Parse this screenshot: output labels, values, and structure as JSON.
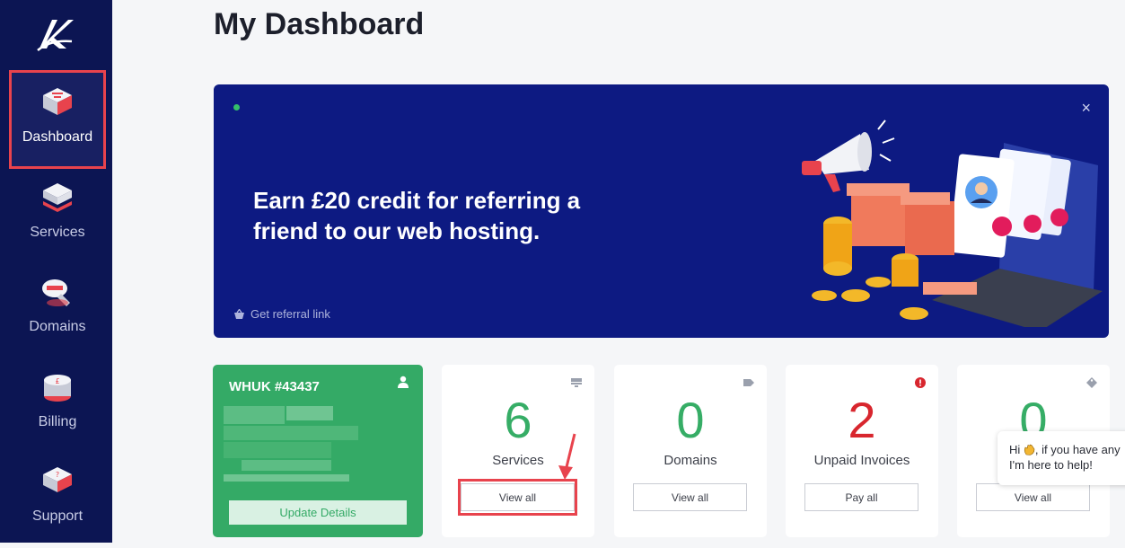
{
  "sidebar": {
    "items": [
      {
        "label": "Dashboard",
        "icon": "dashboard-icon",
        "active": true
      },
      {
        "label": "Services",
        "icon": "services-icon"
      },
      {
        "label": "Domains",
        "icon": "domains-icon"
      },
      {
        "label": "Billing",
        "icon": "billing-icon"
      },
      {
        "label": "Support",
        "icon": "support-icon"
      }
    ]
  },
  "page": {
    "title": "My Dashboard"
  },
  "banner": {
    "headline": "Earn £20 credit for referring a friend to our web hosting.",
    "link_label": "Get referral link",
    "close_label": "×"
  },
  "account": {
    "id": "WHUK #43437",
    "update_label": "Update Details"
  },
  "stats": [
    {
      "count": "6",
      "label": "Services",
      "button": "View all",
      "icon": "server-icon"
    },
    {
      "count": "0",
      "label": "Domains",
      "button": "View all",
      "icon": "tag-icon"
    },
    {
      "count": "2",
      "label": "Unpaid Invoices",
      "button": "Pay all",
      "icon": "alert-icon"
    },
    {
      "count": "0",
      "label": "",
      "button": "View all",
      "icon": "ticket-icon"
    }
  ],
  "chat": {
    "greeting_prefix": "Hi",
    "greeting_suffix": ", if you have any",
    "line2": "I'm here to help!"
  },
  "colors": {
    "sidebar_bg": "#0c1553",
    "banner_bg": "#0d1a82",
    "accent_green": "#36ad66",
    "alert_red": "#d8262e",
    "highlight_red": "#e8434d"
  }
}
